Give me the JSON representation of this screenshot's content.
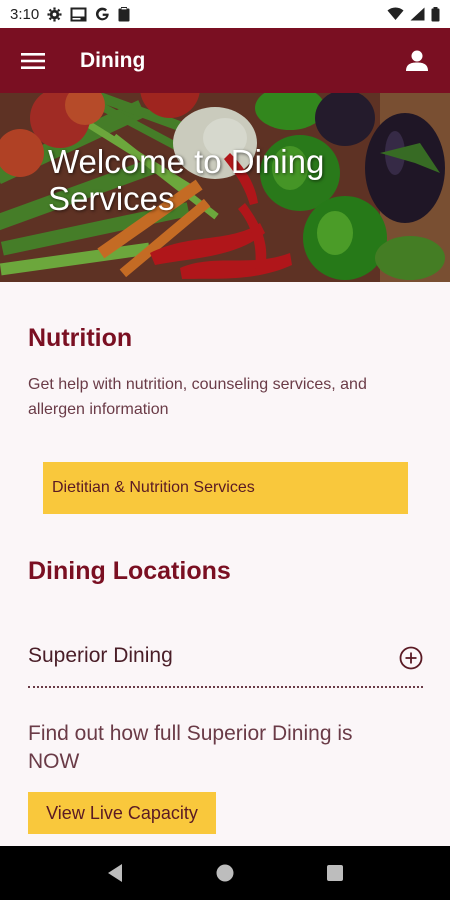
{
  "status_bar": {
    "time": "3:10",
    "left_icons": [
      "gear-icon",
      "image-icon",
      "google-icon",
      "clipboard-icon"
    ],
    "right_icons": [
      "wifi-icon",
      "signal-icon",
      "battery-icon"
    ]
  },
  "app_bar": {
    "title": "Dining",
    "menu_icon": "hamburger-menu-icon",
    "profile_icon": "account-icon",
    "background_color": "#7a0f22"
  },
  "hero": {
    "title": "Welcome to Dining Services"
  },
  "nutrition": {
    "heading": "Nutrition",
    "description": "Get help with nutrition, counseling services, and allergen information",
    "button_label": "Dietitian & Nutrition Services"
  },
  "locations": {
    "heading": "Dining Locations",
    "items": [
      {
        "name": "Superior Dining",
        "icon": "plus-circle-icon",
        "capacity_text": "Find out how full Superior Dining is NOW",
        "capacity_button": "View Live Capacity"
      }
    ]
  },
  "colors": {
    "accent": "#7a0f22",
    "button": "#f9c83c",
    "page_background": "#fbf6f8"
  },
  "nav_bar": {
    "icons": [
      "back-icon",
      "home-icon",
      "recents-icon"
    ]
  }
}
